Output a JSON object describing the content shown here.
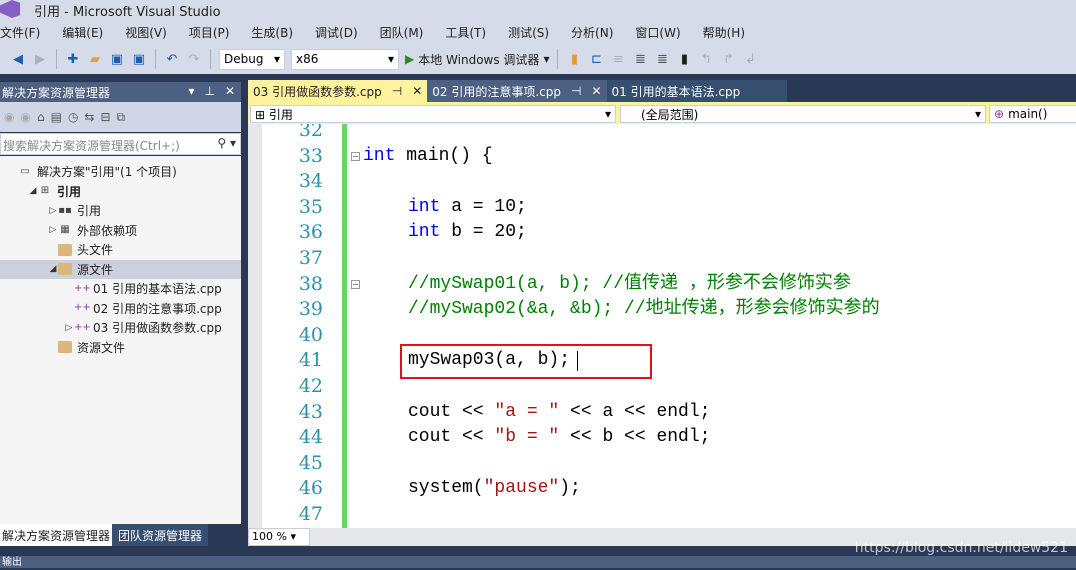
{
  "window": {
    "title": "引用 - Microsoft Visual Studio"
  },
  "menu": [
    "文件(F)",
    "编辑(E)",
    "视图(V)",
    "项目(P)",
    "生成(B)",
    "调试(D)",
    "团队(M)",
    "工具(T)",
    "测试(S)",
    "分析(N)",
    "窗口(W)",
    "帮助(H)"
  ],
  "toolbar": {
    "config": "Debug",
    "platform": "x86",
    "run_label": "本地 Windows 调试器"
  },
  "solution_explorer": {
    "title": "解决方案资源管理器",
    "search_placeholder": "搜索解决方案资源管理器(Ctrl+;)",
    "tree": [
      {
        "label": "解决方案\"引用\"(1 个项目)",
        "level": 0,
        "icon": "solution-icon"
      },
      {
        "label": "引用",
        "level": 1,
        "icon": "project-icon",
        "expanded": true
      },
      {
        "label": "引用",
        "level": 2,
        "icon": "references-icon",
        "collapsed": true
      },
      {
        "label": "外部依赖项",
        "level": 2,
        "icon": "external-deps-icon",
        "collapsed": true
      },
      {
        "label": "头文件",
        "level": 2,
        "icon": "folder-icon"
      },
      {
        "label": "源文件",
        "level": 2,
        "icon": "folder-icon",
        "expanded": true,
        "selected": true
      },
      {
        "label": "01 引用的基本语法.cpp",
        "level": 3,
        "icon": "cpp-file-icon"
      },
      {
        "label": "02 引用的注意事项.cpp",
        "level": 3,
        "icon": "cpp-file-icon"
      },
      {
        "label": "03 引用做函数参数.cpp",
        "level": 3,
        "icon": "cpp-file-icon",
        "collapsed": true
      },
      {
        "label": "资源文件",
        "level": 2,
        "icon": "folder-icon"
      }
    ],
    "bottom_tabs": [
      "解决方案资源管理器",
      "团队资源管理器"
    ]
  },
  "editor": {
    "tabs": [
      {
        "label": "03 引用做函数参数.cpp",
        "active": true
      },
      {
        "label": "02 引用的注意事项.cpp",
        "active": false
      },
      {
        "label": "01 引用的基本语法.cpp",
        "active": false
      }
    ],
    "nav": {
      "project": "引用",
      "scope": "(全局范围)",
      "member": "main()"
    },
    "zoom": "100 %",
    "lines": [
      {
        "n": "32",
        "tokens": []
      },
      {
        "n": "33",
        "tokens": [
          [
            "int",
            "kw"
          ],
          [
            " main() {",
            "fn"
          ]
        ],
        "fold": true,
        "indent": 0
      },
      {
        "n": "34",
        "tokens": []
      },
      {
        "n": "35",
        "tokens": [
          [
            "int",
            "kw"
          ],
          [
            " a = 10;",
            "fn"
          ]
        ],
        "indent": 1
      },
      {
        "n": "36",
        "tokens": [
          [
            "int",
            "kw"
          ],
          [
            " b = 20;",
            "fn"
          ]
        ],
        "indent": 1
      },
      {
        "n": "37",
        "tokens": []
      },
      {
        "n": "38",
        "tokens": [
          [
            "//mySwap01(a, b); //值传递 ，形参不会修饰实参",
            "cm"
          ]
        ],
        "fold": true,
        "indent": 1
      },
      {
        "n": "39",
        "tokens": [
          [
            "//mySwap02(&a, &b); //地址传递，形参会修饰实参的",
            "cm"
          ]
        ],
        "indent": 1
      },
      {
        "n": "40",
        "tokens": []
      },
      {
        "n": "41",
        "tokens": [
          [
            "mySwap03(a, b);",
            "fn"
          ]
        ],
        "indent": 1
      },
      {
        "n": "42",
        "tokens": []
      },
      {
        "n": "43",
        "tokens": [
          [
            "cout << ",
            "fn"
          ],
          [
            "\"a = \"",
            "st"
          ],
          [
            " << a << endl;",
            "fn"
          ]
        ],
        "indent": 1
      },
      {
        "n": "44",
        "tokens": [
          [
            "cout << ",
            "fn"
          ],
          [
            "\"b = \"",
            "st"
          ],
          [
            " << b << endl;",
            "fn"
          ]
        ],
        "indent": 1
      },
      {
        "n": "45",
        "tokens": []
      },
      {
        "n": "46",
        "tokens": [
          [
            "system(",
            "fn"
          ],
          [
            "\"pause\"",
            "st"
          ],
          [
            ");",
            "fn"
          ]
        ],
        "indent": 1
      },
      {
        "n": "47",
        "tokens": []
      }
    ]
  },
  "output_panel": {
    "title": "输出"
  },
  "watermark": "https://blog.csdn.net/lidew521",
  "colors": {
    "accent": "#fff29d",
    "highlight_box": "#e0121c",
    "theme": "#293955"
  }
}
